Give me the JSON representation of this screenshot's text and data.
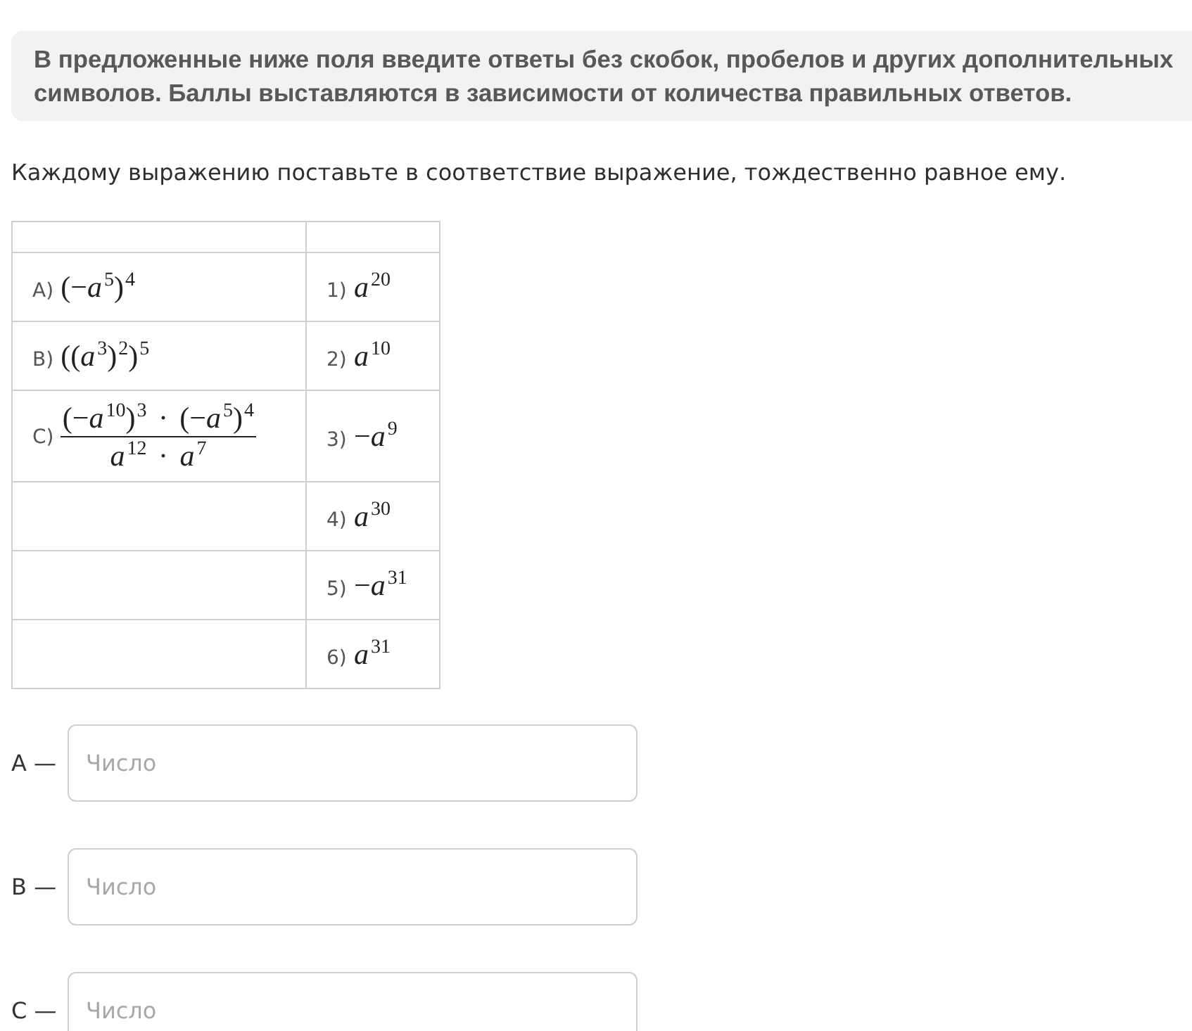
{
  "notice": {
    "text": "В предложенные ниже поля введите ответы без скобок, пробелов и других дополнительных символов. Баллы выставляются в зависимости от количества правильных ответов."
  },
  "prompt": "Каждому выражению поставьте в соответствие выражение, тождественно равное ему.",
  "table": {
    "rows": [
      {
        "left": {
          "kind": "plain",
          "label": "A)",
          "expression": "(−*a*$^{5}$)$^{4}$"
        },
        "right": {
          "label": "1)",
          "expression": "*a*$^{20}$"
        }
      },
      {
        "left": {
          "kind": "plain",
          "label": "B)",
          "expression": "((*a*$^{3}$)$^{2}$)$^{5}$"
        },
        "right": {
          "label": "2)",
          "expression": "*a*$^{10}$"
        }
      },
      {
        "left": {
          "kind": "fraction",
          "label": "C)",
          "numerator": "(−*a*$^{10}$)$^{3}$ · (−*a*$^{5}$)$^{4}$",
          "denominator": "*a*$^{12}$ · *a*$^{7}$"
        },
        "right": {
          "label": "3)",
          "expression": "−*a*$^{9}$"
        }
      },
      {
        "right": {
          "label": "4)",
          "expression": "*a*$^{30}$"
        }
      },
      {
        "right": {
          "label": "5)",
          "expression": "−*a*$^{31}$"
        }
      },
      {
        "right": {
          "label": "6)",
          "expression": "*a*$^{31}$"
        }
      }
    ]
  },
  "answers": [
    {
      "label": "A —",
      "placeholder": "Число"
    },
    {
      "label": "B —",
      "placeholder": "Число"
    },
    {
      "label": "C —",
      "placeholder": "Число"
    }
  ]
}
